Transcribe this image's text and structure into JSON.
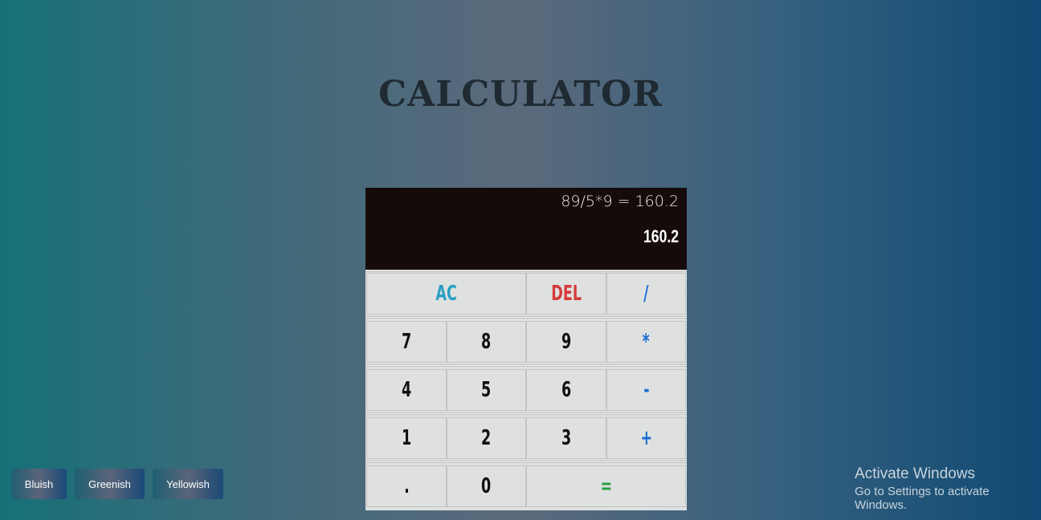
{
  "title": "CALCULATOR",
  "display": {
    "expression": "89/5*9 = 160.2",
    "result": "160.2"
  },
  "keys": {
    "ac": "AC",
    "del": "DEL",
    "divide": "/",
    "k7": "7",
    "k8": "8",
    "k9": "9",
    "multiply": "*",
    "k4": "4",
    "k5": "5",
    "k6": "6",
    "minus": "-",
    "k1": "1",
    "k2": "2",
    "k3": "3",
    "plus": "+",
    "dot": ".",
    "k0": "0",
    "equals": "="
  },
  "themes": {
    "bluish": "Bluish",
    "greenish": "Greenish",
    "yellowish": "Yellowish"
  },
  "watermark": {
    "line1": "Activate Windows",
    "line2": "Go to Settings to activate Windows."
  },
  "colors": {
    "display_bg": "#160b0b",
    "operator": "#1a6fd6",
    "ac": "#2a9fc2",
    "del": "#d63a3a",
    "equals": "#2a9f44"
  }
}
